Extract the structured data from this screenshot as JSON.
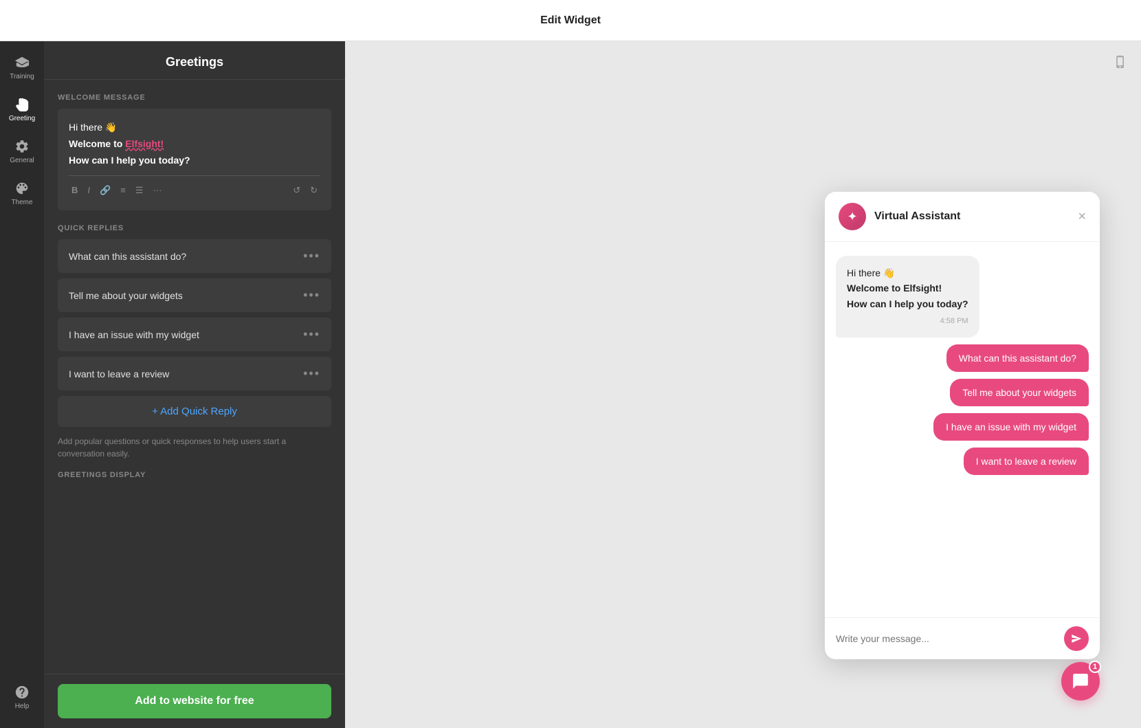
{
  "topBar": {
    "title": "Edit Widget"
  },
  "iconSidebar": {
    "items": [
      {
        "id": "training",
        "label": "Training",
        "icon": "graduation"
      },
      {
        "id": "greeting",
        "label": "Greeting",
        "icon": "hand",
        "active": true
      },
      {
        "id": "general",
        "label": "General",
        "icon": "gear"
      },
      {
        "id": "theme",
        "label": "Theme",
        "icon": "palette"
      }
    ]
  },
  "panel": {
    "title": "Greetings",
    "welcomeMessageLabel": "WELCOME MESSAGE",
    "welcomeMessage": {
      "line1": "Hi there 👋",
      "line2prefix": "Welcome to ",
      "line2brand": "Elfsight!",
      "line3": "How can I help you today?"
    },
    "quickRepliesLabel": "QUICK REPLIES",
    "quickReplies": [
      {
        "id": 1,
        "text": "What can this assistant do?"
      },
      {
        "id": 2,
        "text": "Tell me about your widgets"
      },
      {
        "id": 3,
        "text": "I have an issue with my widget"
      },
      {
        "id": 4,
        "text": "I want to leave a review"
      }
    ],
    "addQuickReplyLabel": "+ Add Quick Reply",
    "quickReplyHint": "Add popular questions or quick responses to help users start a conversation easily.",
    "greetingsDisplayLabel": "GREETINGS DISPLAY",
    "addToWebsiteLabel": "Add to website for free"
  },
  "chatPreview": {
    "title": "Virtual Assistant",
    "closeLabel": "×",
    "welcomeMessage": {
      "line1": "Hi there 👋",
      "line2": "Welcome to Elfsight!",
      "line3": "How can I help you today?",
      "time": "4:58 PM"
    },
    "quickReplies": [
      "What can this assistant do?",
      "Tell me about your widgets",
      "I have an issue with my widget",
      "I want to leave a review"
    ],
    "inputPlaceholder": "Write your message...",
    "floatBadge": "1"
  }
}
